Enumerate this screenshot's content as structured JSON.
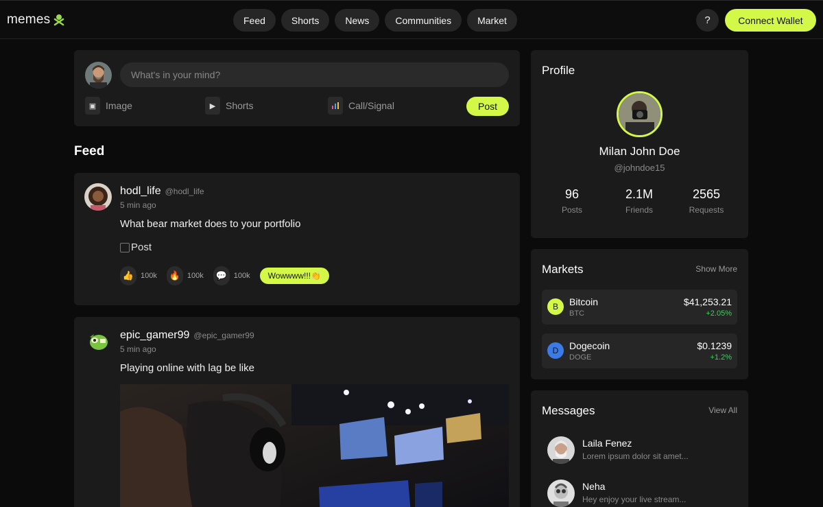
{
  "header": {
    "logo_text": "memes",
    "nav": [
      "Feed",
      "Shorts",
      "News",
      "Communities",
      "Market"
    ],
    "help_label": "?",
    "wallet_label": "Connect Wallet"
  },
  "composer": {
    "placeholder": "What's in your mind?",
    "actions": [
      "Image",
      "Shorts",
      "Call/Signal"
    ],
    "post_label": "Post"
  },
  "feed": {
    "title": "Feed",
    "posts": [
      {
        "user": "hodl_life",
        "handle": "@hodl_life",
        "time": "5 min ago",
        "text": "What bear market does to your portfolio",
        "image_alt": "Post",
        "reactions": [
          {
            "icon": "thumbs-up-icon",
            "glyph": "👍",
            "count": "100k"
          },
          {
            "icon": "fire-icon",
            "glyph": "🔥",
            "count": "100k"
          },
          {
            "icon": "comment-icon",
            "glyph": "💬",
            "count": "100k"
          }
        ],
        "badge": "Wowwww!!!👏"
      },
      {
        "user": "epic_gamer99",
        "handle": "@epic_gamer99",
        "time": "5 min ago",
        "text": "Playing online with lag be like"
      }
    ]
  },
  "profile": {
    "title": "Profile",
    "name": "Milan John Doe",
    "handle": "@johndoe15",
    "stats": [
      {
        "value": "96",
        "label": "Posts"
      },
      {
        "value": "2.1M",
        "label": "Friends"
      },
      {
        "value": "2565",
        "label": "Requests"
      }
    ]
  },
  "markets": {
    "title": "Markets",
    "link": "Show More",
    "items": [
      {
        "letter": "B",
        "name": "Bitcoin",
        "symbol": "BTC",
        "price": "$41,253.21",
        "change": "+2.05%",
        "color": "#d4f847"
      },
      {
        "letter": "D",
        "name": "Dogecoin",
        "symbol": "DOGE",
        "price": "$0.1239",
        "change": "+1.2%",
        "color": "#3b7be8"
      }
    ]
  },
  "messages": {
    "title": "Messages",
    "link": "View All",
    "items": [
      {
        "name": "Laila Fenez",
        "preview": "Lorem ipsum dolor sit amet..."
      },
      {
        "name": "Neha",
        "preview": "Hey enjoy your live stream..."
      }
    ]
  },
  "colors": {
    "accent": "#d4f847",
    "card": "#1b1b1b",
    "background": "#0b0b0b",
    "positive": "#3fcf5c"
  }
}
